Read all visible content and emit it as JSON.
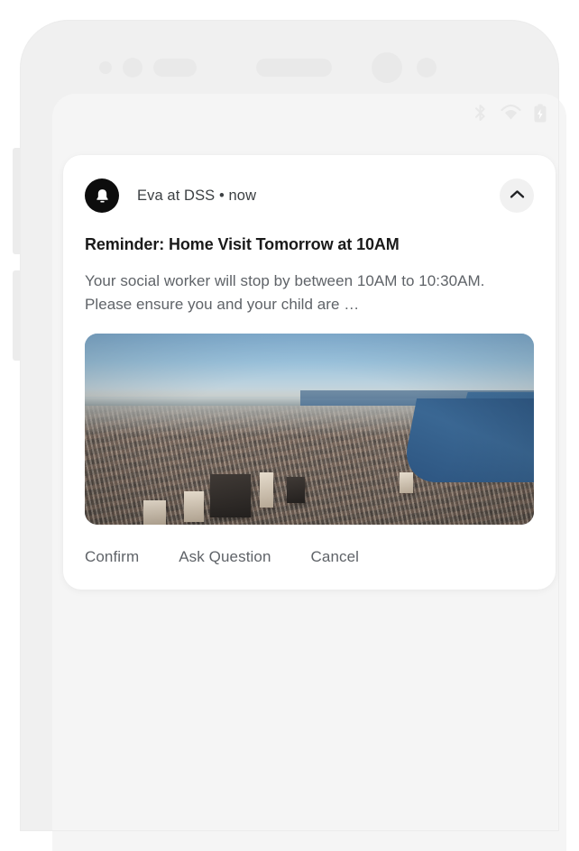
{
  "device": {
    "frame_name": "smartphone-mockup",
    "sensors": [
      "sensor-dot-small",
      "sensor-dot-medium",
      "sensor-pill",
      "earpiece-speaker",
      "front-camera",
      "sensor-dot-large"
    ],
    "buttons": [
      "volume-up",
      "volume-down",
      "power"
    ],
    "screen_background": "#f5f5f5",
    "frame_color": "#f0f0f0"
  },
  "status_bar": {
    "icons": [
      "bluetooth-icon",
      "wifi-icon",
      "battery-charging-icon"
    ],
    "icon_color": "#e8e8e8"
  },
  "notification": {
    "app_icon": "bell-icon",
    "sender": "Eva at DSS • now",
    "title": "Reminder: Home Visit Tomorrow at 10AM",
    "body": "Your social worker will stop by between 10AM to 10:30AM. Please ensure you and your child are …",
    "collapse_icon": "chevron-up-icon",
    "image": {
      "name": "aerial-cityscape-photo",
      "description": "Aerial view of dense Manhattan cityscape with blue sky and river",
      "sky_color": "#8fb9da",
      "water_color": "#33608c",
      "city_color": "#8a817a"
    },
    "actions": [
      {
        "label": "Confirm",
        "name": "confirm-button"
      },
      {
        "label": "Ask Question",
        "name": "ask-question-button"
      },
      {
        "label": "Cancel",
        "name": "cancel-button"
      }
    ]
  }
}
